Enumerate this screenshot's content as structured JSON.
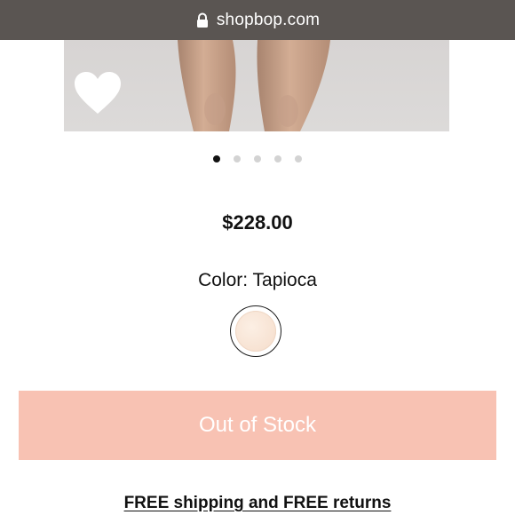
{
  "browser": {
    "url": "shopbop.com",
    "lock_icon": "lock-icon"
  },
  "product": {
    "image_icon": "product-photo",
    "wishlist_icon": "heart-icon",
    "carousel": {
      "total": 5,
      "active_index": 0
    },
    "price": "$228.00",
    "color_label": "Color: Tapioca",
    "swatch_color": "#f7e2d2"
  },
  "actions": {
    "out_of_stock_label": "Out of Stock",
    "out_of_stock_color": "#f8c2b3"
  },
  "shipping": {
    "text": "FREE shipping and FREE returns"
  }
}
